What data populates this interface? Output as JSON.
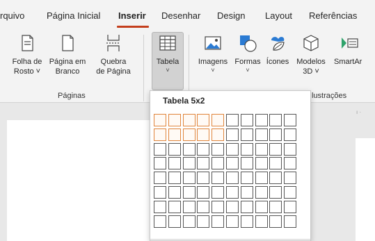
{
  "tabs": [
    {
      "label": "rquivo",
      "active": false
    },
    {
      "label": "Página Inicial",
      "active": false
    },
    {
      "label": "Inserir",
      "active": true
    },
    {
      "label": "Desenhar",
      "active": false
    },
    {
      "label": "Design",
      "active": false
    },
    {
      "label": "Layout",
      "active": false
    },
    {
      "label": "Referências",
      "active": false
    }
  ],
  "ribbon": {
    "paginas": {
      "folha_de_rosto": {
        "line1": "Folha de",
        "line2": "Rosto ˅",
        "icon": "cover-page-icon"
      },
      "pagina_em_branco": {
        "line1": "Página em",
        "line2": "Branco",
        "icon": "blank-page-icon"
      },
      "quebra_de_pagina": {
        "line1": "Quebra",
        "line2": "de Página",
        "icon": "page-break-icon"
      },
      "group_label": "Páginas"
    },
    "tabela": {
      "line1": "Tabela",
      "caret": "˅",
      "icon": "table-icon"
    },
    "ilustracoes": {
      "imagens": {
        "line1": "Imagens",
        "caret": "˅",
        "icon": "image-icon"
      },
      "formas": {
        "line1": "Formas",
        "caret": "˅",
        "icon": "shapes-icon"
      },
      "icones": {
        "line1": "Ícones",
        "icon": "icons-icon"
      },
      "modelos_3d": {
        "line1": "Modelos",
        "line2": "3D ˅",
        "icon": "3d-models-icon"
      },
      "smartart": {
        "line1": "SmartAr",
        "icon": "smartart-icon"
      },
      "group_label": "lustrações"
    }
  },
  "table_dropdown": {
    "title": "Tabela 5x2",
    "highlight_cols": 5,
    "highlight_rows": 2,
    "total_cols": 10,
    "total_rows": 8
  },
  "colors": {
    "accent": "#c43e1c",
    "highlight_border": "#e0843a",
    "ribbon_bg": "#f3f3f3"
  }
}
